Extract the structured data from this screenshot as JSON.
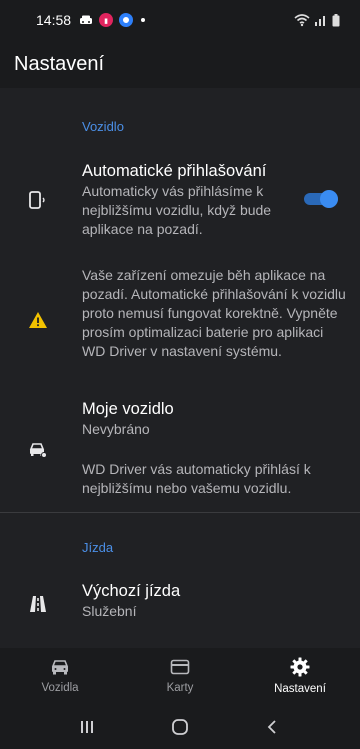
{
  "status_bar": {
    "time": "14:58",
    "indicators": [
      "car-icon",
      "app-notification-icon",
      "app-icon",
      "dot"
    ],
    "right_icons": [
      "wifi-icon",
      "signal-icon",
      "battery-icon"
    ]
  },
  "app_bar": {
    "title": "Nastavení"
  },
  "sections": {
    "vehicle": {
      "header": "Vozidlo",
      "auto_login": {
        "title": "Automatické přihlašování",
        "subtitle": "Automaticky vás přihlásíme k nejbližšímu vozidlu, když bude aplikace na pozadí.",
        "enabled": true
      },
      "warning": {
        "text": "Vaše zařízení omezuje běh aplikace na pozadí. Automatické přihlašování k vozidlu proto nemusí fungovat korektně. Vypněte prosím optimalizaci baterie pro aplikaci WD Driver v nastavení systému."
      },
      "my_vehicle": {
        "title": "Moje vozidlo",
        "subtitle": "Nevybráno",
        "description": "WD Driver vás automaticky přihlásí k nejbližšímu nebo vašemu vozidlu."
      }
    },
    "ride": {
      "header": "Jízda",
      "default_ride": {
        "title": "Výchozí jízda",
        "subtitle": "Služební"
      }
    }
  },
  "bottom_nav": {
    "items": [
      {
        "label": "Vozidla",
        "icon": "car-icon",
        "active": false
      },
      {
        "label": "Karty",
        "icon": "card-icon",
        "active": false
      },
      {
        "label": "Nastavení",
        "icon": "gear-icon",
        "active": true
      }
    ]
  },
  "colors": {
    "accent": "#3a8cf2",
    "section_header": "#4b8fe6",
    "warning": "#f2c200",
    "background": "#202124",
    "bar": "#1a1b1d"
  }
}
